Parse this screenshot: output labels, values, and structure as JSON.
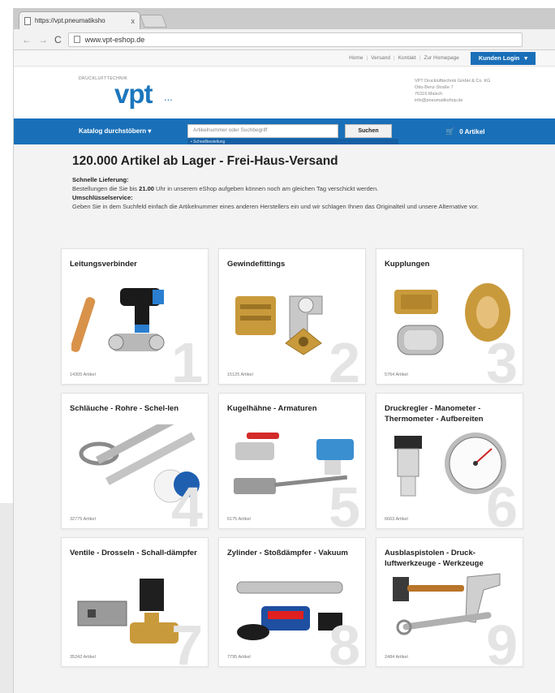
{
  "browser": {
    "tab_title": "https://vpt.pneumatiksho",
    "tab_close": "x",
    "url": "www.vpt-eshop.de",
    "back": "←",
    "forward": "→",
    "reload": "C"
  },
  "toplinks": {
    "items": [
      "Home",
      "Versand",
      "Kontakt",
      "Zur Homepage"
    ],
    "separator": "|",
    "login": "Kunden Login",
    "login_caret": "▾"
  },
  "header": {
    "logo_tag": "DRUCKLUFTTECHNIK",
    "logo": "vpt",
    "logo_dots": "...",
    "company_lines": [
      "VPT Drucklufttechnik GmbH & Co. KG",
      "Otto-Benz-Straße 7",
      "76316 Malsch",
      "info@pneumatikshop.de"
    ]
  },
  "nav": {
    "katalog": "Katalog durchstöbern",
    "katalog_caret": "▾",
    "search_placeholder": "Artikelnummer oder Suchbegriff",
    "search_button": "Suchen",
    "quick_hint": "• Schnellbestellung",
    "cart": "0 Artikel",
    "cart_icon": "🛒"
  },
  "main": {
    "headline": "120.000 Artikel ab Lager - Frei-Haus-Versand",
    "l1_label": "Schnelle Lieferung:",
    "l1_pre": "Bestellungen die Sie bis",
    "l1_bold": "21.00",
    "l1_post": "Uhr in unserem eShop aufgeben können noch am gleichen Tag verschickt werden.",
    "l2_label": "Umschlüsselservice:",
    "l2_text": "Geben Sie in dem Suchfeld einfach die Artikelnummer eines anderen Herstellers ein und wir schlagen Ihnen das Originalteil und unsere Alternative vor."
  },
  "categories": [
    {
      "title": "Leitungsverbinder",
      "count": "14305 Artikel",
      "num": "1",
      "icon": "push-in-fittings"
    },
    {
      "title": "Gewindefittings",
      "count": "15125 Artikel",
      "num": "2",
      "icon": "brass-fittings"
    },
    {
      "title": "Kupplungen",
      "count": "5764 Artikel",
      "num": "3",
      "icon": "couplings"
    },
    {
      "title": "Schläuche - Rohre - Schel-len",
      "count": "32775 Artikel",
      "num": "4",
      "icon": "hoses-pipes"
    },
    {
      "title": "Kugelhähne - Armaturen",
      "count": "6175 Artikel",
      "num": "5",
      "icon": "ball-valves"
    },
    {
      "title": "Druckregler - Manometer - Thermometer - Aufbereiten",
      "count": "6663 Artikel",
      "num": "6",
      "icon": "pressure-gauge"
    },
    {
      "title": "Ventile - Drosseln - Schall-dämpfer",
      "count": "35242 Artikel",
      "num": "7",
      "icon": "solenoid-valves"
    },
    {
      "title": "Zylinder - Stoßdämpfer - Vakuum",
      "count": "7795 Artikel",
      "num": "8",
      "icon": "cylinders"
    },
    {
      "title": "Ausblaspistolen - Druck-luftwerkzeuge - Werkzeuge",
      "count": "2484 Artikel",
      "num": "9",
      "icon": "tools"
    }
  ],
  "colors": {
    "brand_blue": "#1a70b8",
    "page_bg": "#f3f3f3"
  }
}
